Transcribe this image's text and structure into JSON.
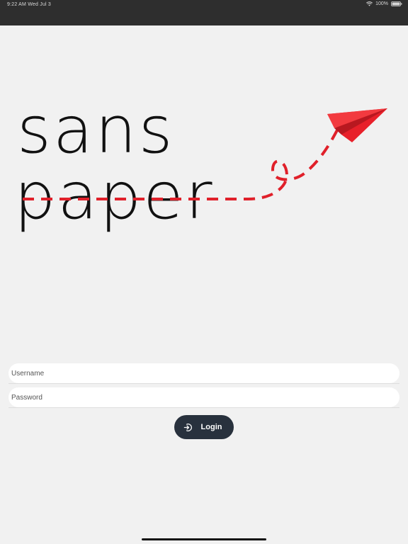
{
  "status_bar": {
    "time_date": "9:22 AM  Wed Jul 3",
    "battery": "100%"
  },
  "logo": {
    "line1": "sans",
    "line2": "paper",
    "ink_color": "#111111",
    "accent_color": "#e0202a",
    "icon": "paper-plane-icon"
  },
  "form": {
    "username_placeholder": "Username",
    "password_placeholder": "Password",
    "login_label": "Login",
    "login_icon": "login-arrow-icon"
  },
  "colors": {
    "background": "#f1f1f1",
    "status_bar": "#2e2e2e",
    "button": "#28313d"
  }
}
